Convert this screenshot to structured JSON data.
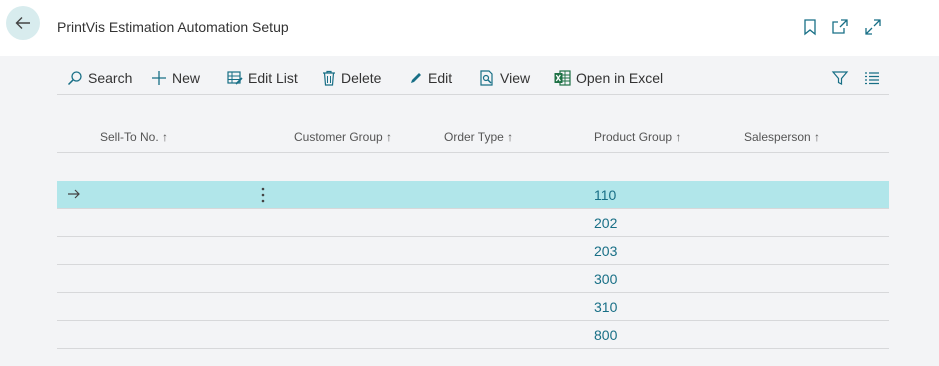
{
  "header": {
    "title": "PrintVis Estimation Automation Setup"
  },
  "toolbar": {
    "search_label": "Search",
    "new_label": "New",
    "edit_list_label": "Edit List",
    "delete_label": "Delete",
    "edit_label": "Edit",
    "view_label": "View",
    "open_excel_label": "Open in Excel"
  },
  "columns": {
    "sell_to_no": "Sell-To No. ↑",
    "customer_group": "Customer Group ↑",
    "order_type": "Order Type ↑",
    "product_group": "Product Group ↑",
    "salesperson": "Salesperson ↑"
  },
  "rows": [
    {
      "product_group": "110"
    },
    {
      "product_group": "202"
    },
    {
      "product_group": "203"
    },
    {
      "product_group": "300"
    },
    {
      "product_group": "310"
    },
    {
      "product_group": "800"
    }
  ],
  "colors": {
    "accent": "#186f86",
    "selected_row": "#b1e6ea",
    "back_button": "#d8ecee",
    "excel_green": "#1e7145"
  },
  "icons": [
    "back-arrow-icon",
    "bookmark-icon",
    "open-new-window-icon",
    "expand-icon",
    "search-icon",
    "plus-icon",
    "edit-list-icon",
    "trash-icon",
    "pencil-icon",
    "view-icon",
    "excel-icon",
    "filter-icon",
    "list-icon",
    "row-arrow-icon",
    "more-vertical-icon"
  ]
}
